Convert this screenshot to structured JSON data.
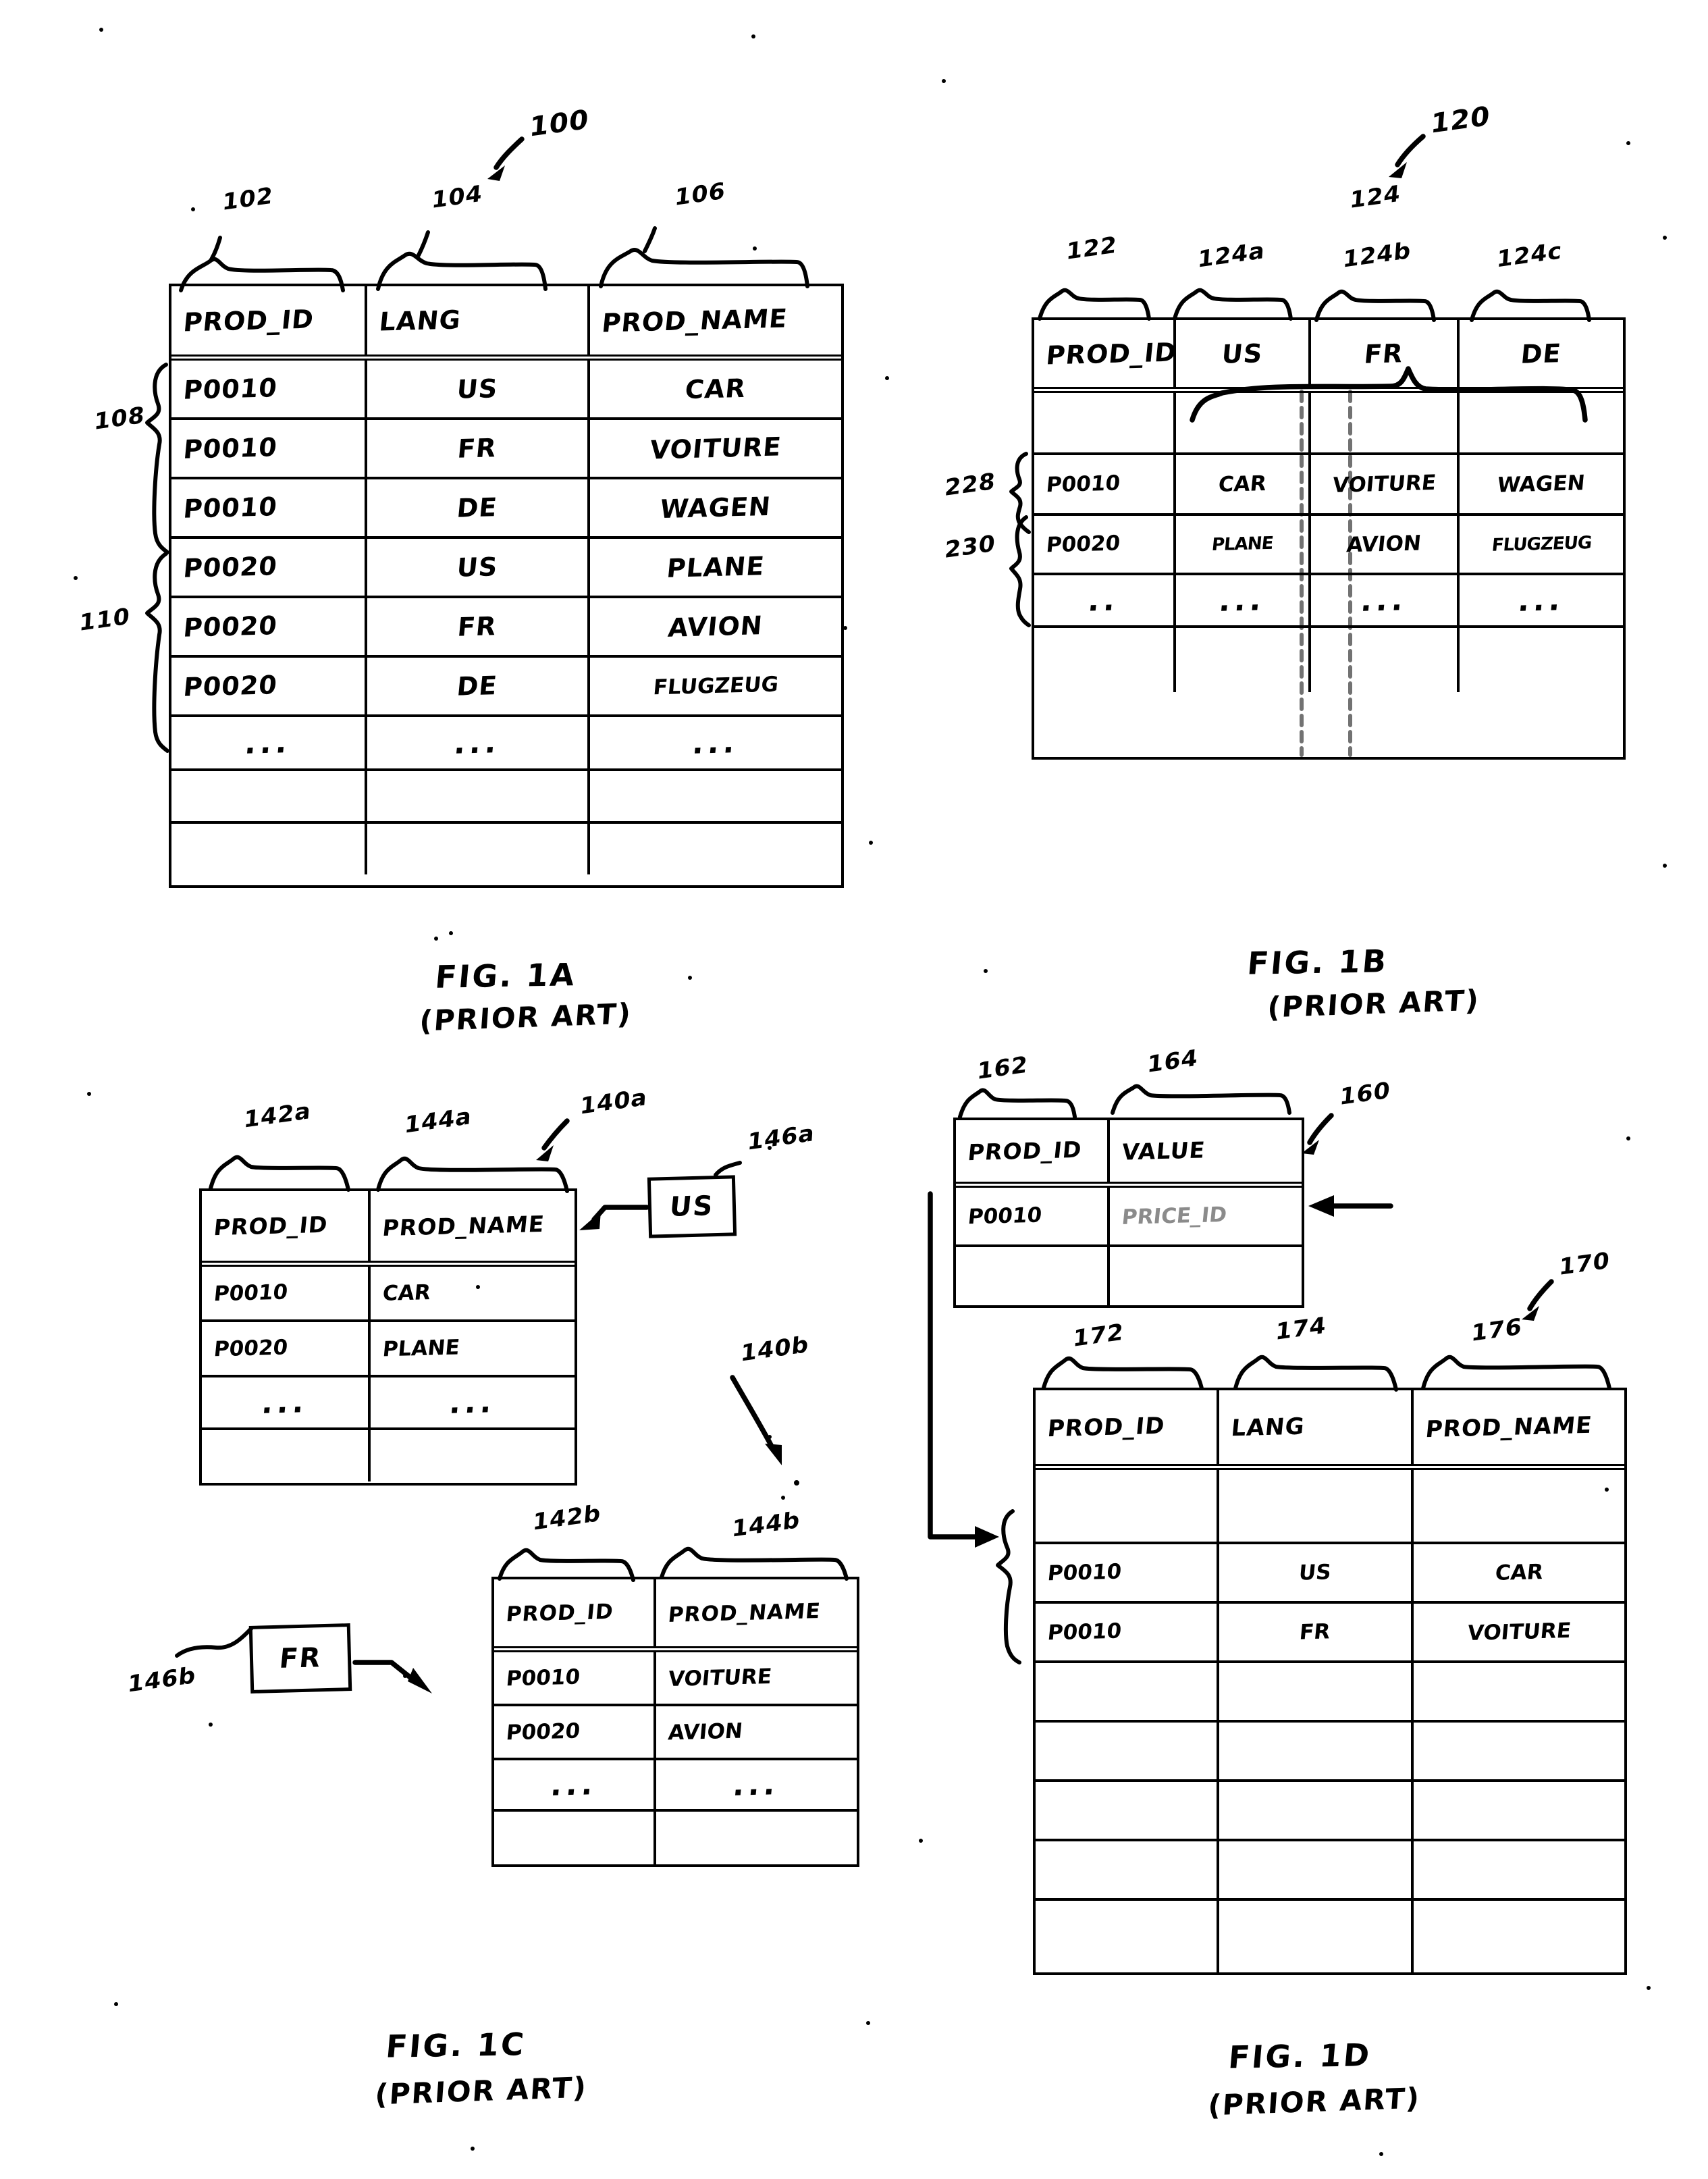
{
  "sheet": {
    "title": "Patent drawing sheet - FIGS. 1A-1D (Prior Art)"
  },
  "fig1a": {
    "fig_ref": "100",
    "caption_line1": "FIG. 1A",
    "caption_line2": "(PRIOR ART)",
    "column_refs": [
      "102",
      "104",
      "106"
    ],
    "group_refs": [
      "108",
      "110"
    ],
    "headers": [
      "PROD_ID",
      "LANG",
      "PROD_NAME"
    ],
    "rows": [
      [
        "P0010",
        "US",
        "CAR"
      ],
      [
        "P0010",
        "FR",
        "VOITURE"
      ],
      [
        "P0010",
        "DE",
        "WAGEN"
      ],
      [
        "P0020",
        "US",
        "PLANE"
      ],
      [
        "P0020",
        "FR",
        "AVION"
      ],
      [
        "P0020",
        "DE",
        "FLUGZEUG"
      ],
      [
        "...",
        "...",
        "..."
      ],
      [
        "",
        "",
        ""
      ],
      [
        "",
        "",
        ""
      ]
    ]
  },
  "fig1b": {
    "fig_ref": "120",
    "caption_line1": "FIG. 1B",
    "caption_line2": "(PRIOR ART)",
    "column_refs": [
      "122",
      "124"
    ],
    "sub_column_refs": [
      "124a",
      "124b",
      "124c"
    ],
    "row_refs": [
      "228",
      "230"
    ],
    "headers": [
      "PROD_ID",
      "US",
      "FR",
      "DE"
    ],
    "rows": [
      [
        "",
        "",
        "",
        ""
      ],
      [
        "P0010",
        "CAR",
        "VOITURE",
        "WAGEN"
      ],
      [
        "P0020",
        "PLANE",
        "AVION",
        "FLUGZEUG"
      ],
      [
        "..",
        "...",
        "...",
        "..."
      ],
      [
        "",
        "",
        "",
        ""
      ],
      [
        "",
        "",
        "",
        ""
      ]
    ]
  },
  "fig1c": {
    "caption_line1": "FIG. 1C",
    "caption_line2": "(PRIOR ART)",
    "table_a": {
      "fig_ref": "140a",
      "column_refs": [
        "142a",
        "144a"
      ],
      "lang_box_ref": "146a",
      "lang_box_value": "US",
      "headers": [
        "PROD_ID",
        "PROD_NAME"
      ],
      "rows": [
        [
          "P0010",
          "CAR"
        ],
        [
          "P0020",
          "PLANE"
        ],
        [
          "...",
          "..."
        ],
        [
          "",
          ""
        ]
      ]
    },
    "table_b": {
      "fig_ref": "140b",
      "column_refs": [
        "142b",
        "144b"
      ],
      "lang_box_ref": "146b",
      "lang_box_value": "FR",
      "headers": [
        "PROD_ID",
        "PROD_NAME"
      ],
      "rows": [
        [
          "P0010",
          "VOITURE"
        ],
        [
          "P0020",
          "AVION"
        ],
        [
          "...",
          "..."
        ],
        [
          "",
          ""
        ]
      ]
    }
  },
  "fig1d": {
    "caption_line1": "FIG. 1D",
    "caption_line2": "(PRIOR ART)",
    "table_value": {
      "fig_ref": "160",
      "column_refs": [
        "162",
        "164"
      ],
      "headers": [
        "PROD_ID",
        "VALUE"
      ],
      "rows": [
        [
          "P0010",
          "PRICE_ID"
        ],
        [
          "",
          ""
        ]
      ]
    },
    "table_lang": {
      "fig_ref": "170",
      "column_refs": [
        "172",
        "174",
        "176"
      ],
      "headers": [
        "PROD_ID",
        "LANG",
        "PROD_NAME"
      ],
      "rows": [
        [
          "",
          "",
          ""
        ],
        [
          "P0010",
          "US",
          "CAR"
        ],
        [
          "P0010",
          "FR",
          "VOITURE"
        ],
        [
          "",
          "",
          ""
        ],
        [
          "",
          "",
          ""
        ],
        [
          "",
          "",
          ""
        ],
        [
          "",
          "",
          ""
        ],
        [
          "",
          "",
          ""
        ],
        [
          "",
          "",
          ""
        ]
      ]
    }
  }
}
